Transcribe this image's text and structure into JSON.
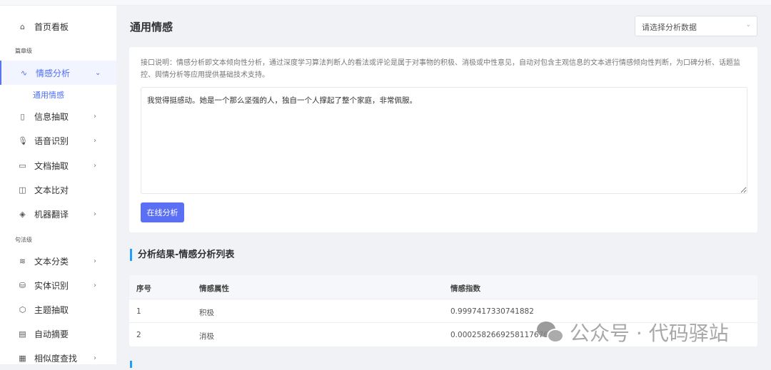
{
  "sidebar": {
    "groups": [
      "篇章级",
      "句法级"
    ],
    "items": [
      {
        "label": "首页看板",
        "icon": "home-icon"
      },
      {
        "label": "情感分析",
        "icon": "activity-icon"
      },
      {
        "label": "信息抽取",
        "icon": "bookmark-icon"
      },
      {
        "label": "语音识别",
        "icon": "microphone-icon"
      },
      {
        "label": "文档抽取",
        "icon": "document-icon"
      },
      {
        "label": "文本比对",
        "icon": "columns-icon"
      },
      {
        "label": "机器翻译",
        "icon": "codepen-icon"
      },
      {
        "label": "文本分类",
        "icon": "layers-icon"
      },
      {
        "label": "实体识别",
        "icon": "database-icon"
      },
      {
        "label": "主题抽取",
        "icon": "box-icon"
      },
      {
        "label": "自动摘要",
        "icon": "file-text-icon"
      },
      {
        "label": "相似度查找",
        "icon": "grid-icon"
      }
    ],
    "sub_item": "通用情感"
  },
  "header": {
    "title": "通用情感",
    "select_placeholder": "请选择分析数据"
  },
  "card": {
    "description": "接口说明：情感分析即文本倾向性分析，通过深度学习算法判断人的看法或评论是属于对事物的积极、消极或中性意见，自动对包含主观信息的文本进行情感倾向性判断，为口碑分析、话题监控、舆情分析等应用提供基础技术支持。",
    "input_text": "我觉得挺感动。她是一个那么坚强的人，独自一个人撑起了整个家庭，非常佩服。",
    "button": "在线分析"
  },
  "results": {
    "title": "分析结果-情感分析列表",
    "columns": [
      "序号",
      "情感属性",
      "情感指数"
    ],
    "rows": [
      [
        "1",
        "积极",
        "0.9997417330741882"
      ],
      [
        "2",
        "消极",
        "0.0002582669258117676"
      ]
    ]
  },
  "watermark": "公众号 · 代码驿站",
  "colors": {
    "accent": "#4e6ef2",
    "section_bar": "#1e9fff"
  }
}
